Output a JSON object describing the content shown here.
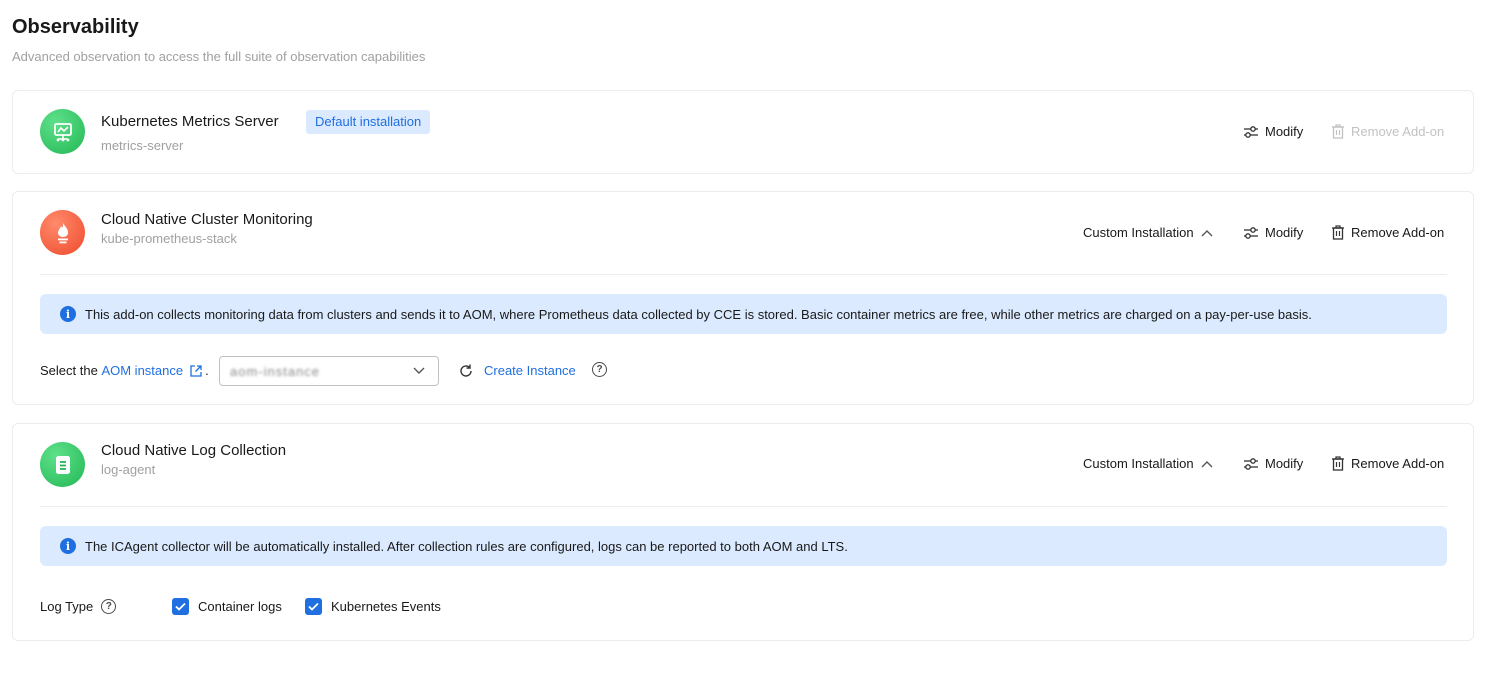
{
  "page": {
    "title": "Observability",
    "subtitle": "Advanced observation to access the full suite of observation capabilities"
  },
  "addons": [
    {
      "name": "Kubernetes Metrics Server",
      "id": "metrics-server",
      "badge": "Default installation",
      "modify_label": "Modify",
      "remove_label": "Remove Add-on",
      "remove_disabled": true
    },
    {
      "name": "Cloud Native Cluster Monitoring",
      "id": "kube-prometheus-stack",
      "install_mode": "Custom Installation",
      "modify_label": "Modify",
      "remove_label": "Remove Add-on",
      "info": "This add-on collects monitoring data from clusters and sends it to AOM, where Prometheus data collected by CCE is stored. Basic container metrics are free, while other metrics are charged on a pay-per-use basis.",
      "select_prefix": "Select the",
      "select_link": "AOM instance",
      "select_suffix": ".",
      "select_value": "aom-instance",
      "create_label": "Create Instance"
    },
    {
      "name": "Cloud Native Log Collection",
      "id": "log-agent",
      "install_mode": "Custom Installation",
      "modify_label": "Modify",
      "remove_label": "Remove Add-on",
      "info": "The ICAgent collector will be automatically installed. After collection rules are configured, logs can be reported to both AOM and LTS.",
      "log_type_label": "Log Type",
      "log_types": [
        {
          "label": "Container logs",
          "checked": true
        },
        {
          "label": "Kubernetes Events",
          "checked": true
        }
      ]
    }
  ],
  "colors": {
    "accent": "#1f6fe0",
    "info_bg": "#dbeaff",
    "metrics_icon": "#22b855",
    "prometheus_icon": "#ee4a2c",
    "log_icon": "#22b855"
  }
}
